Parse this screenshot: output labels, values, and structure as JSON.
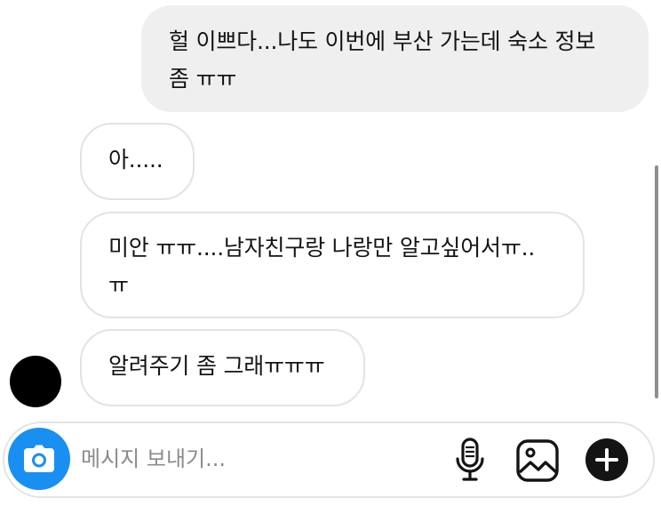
{
  "messages": [
    {
      "direction": "outgoing",
      "lines": [
        "헐 이쁘다...나도 이번에 부산 가는데 숙소 정보",
        "좀 ㅠㅠ"
      ]
    },
    {
      "direction": "incoming",
      "lines": [
        "아....."
      ]
    },
    {
      "direction": "incoming",
      "lines": [
        "미안 ㅠㅠ....남자친구랑 나랑만 알고싶어서ㅠ..",
        "ㅠ"
      ]
    },
    {
      "direction": "incoming",
      "lines": [
        "알려주기 좀 그래ㅠㅠㅠ"
      ]
    }
  ],
  "composer": {
    "placeholder": "메시지 보내기...",
    "value": ""
  },
  "icons": {
    "camera": "camera-icon",
    "microphone": "microphone-icon",
    "gallery": "gallery-icon",
    "add": "plus-icon"
  },
  "colors": {
    "outgoing_bubble": "#efefef",
    "incoming_border": "#e3e3e3",
    "camera_button": "#1a8ff2",
    "avatar": "#000000",
    "placeholder": "#8b8b8b"
  }
}
